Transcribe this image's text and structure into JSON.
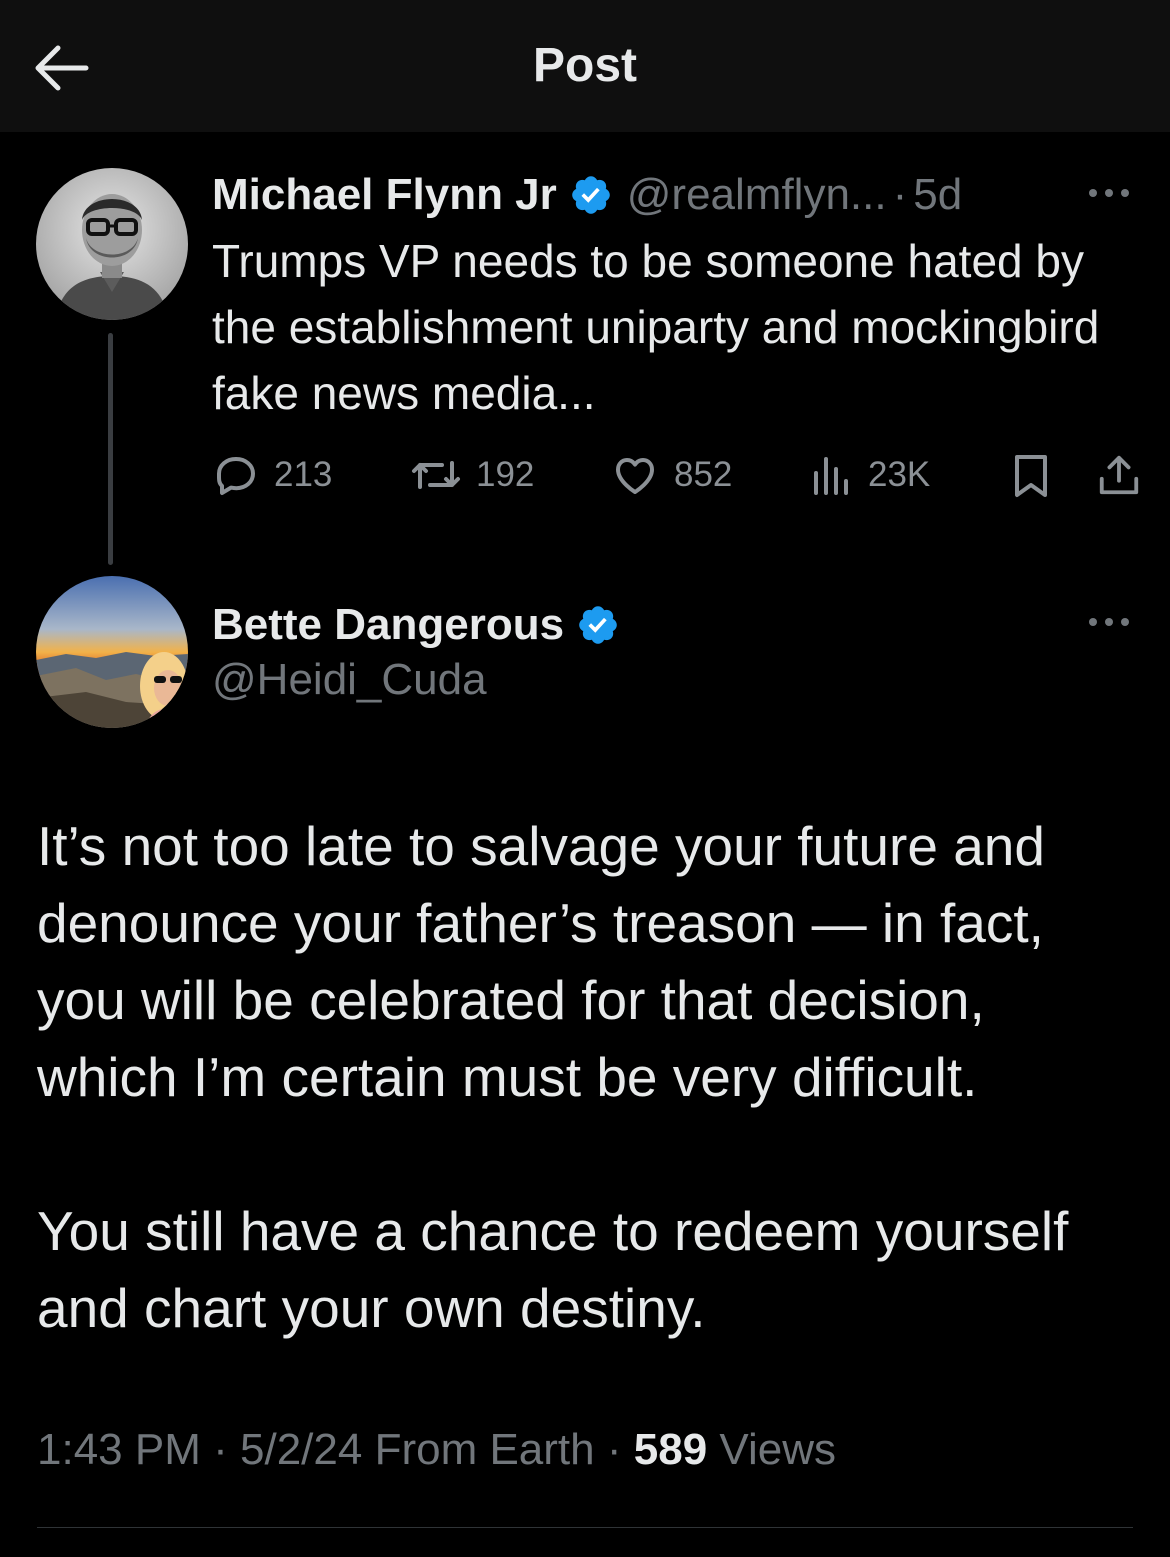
{
  "header": {
    "title": "Post"
  },
  "quoted_post": {
    "author_name": "Michael Flynn Jr",
    "author_handle": "@realmflyn...",
    "separator": "·",
    "time_ago": "5d",
    "text": "Trumps VP needs to be someone hated by the establishment uniparty and mockingbird fake news media...",
    "stats": {
      "replies": "213",
      "reposts": "192",
      "likes": "852",
      "views": "23K"
    }
  },
  "main_post": {
    "author_name": "Bette Dangerous",
    "author_handle": "@Heidi_Cuda",
    "paragraphs": [
      "It’s not too late to salvage your future and denounce your father’s treason — in fact, you will be celebrated for that decision, which I’m certain must be very difficult.",
      "You still have a chance to redeem yourself and chart your own destiny."
    ],
    "meta": {
      "time": "1:43 PM",
      "date": "5/2/24",
      "source": "From Earth",
      "views_count": "589",
      "views_label": "Views",
      "separator": "·"
    }
  },
  "colors": {
    "background": "#000000",
    "header_background": "#0f0f0f",
    "text_primary": "#e7e9ea",
    "text_secondary": "#71767b",
    "verified_blue": "#1d9bf0",
    "thread_line": "#3a3d41"
  },
  "icons": {
    "back": "back-arrow-icon",
    "verified": "verified-badge-icon",
    "more": "more-options-icon",
    "reply": "reply-icon",
    "repost": "repost-icon",
    "like": "heart-icon",
    "views": "views-bar-chart-icon",
    "bookmark": "bookmark-icon",
    "share": "share-icon"
  }
}
